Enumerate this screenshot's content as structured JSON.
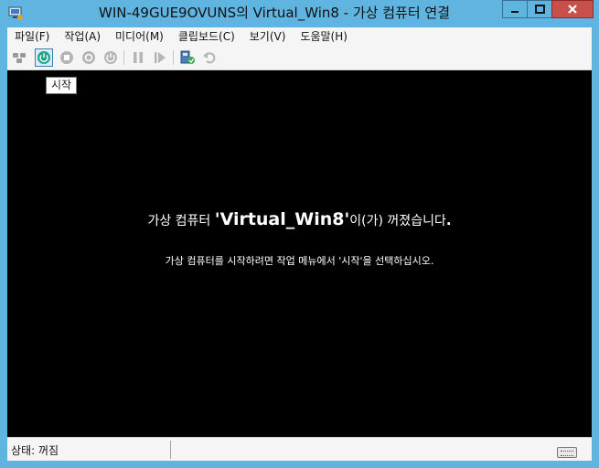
{
  "window": {
    "title": "WIN-49GUE9OVUNS의 Virtual_Win8 - 가상 컴퓨터 연결"
  },
  "menubar": {
    "items": [
      {
        "label": "파일(F)"
      },
      {
        "label": "작업(A)"
      },
      {
        "label": "미디어(M)"
      },
      {
        "label": "클립보드(C)"
      },
      {
        "label": "보기(V)"
      },
      {
        "label": "도움말(H)"
      }
    ]
  },
  "toolbar": {
    "tooltip": "시작",
    "buttons": [
      {
        "icon": "ctrl-alt-del-icon"
      },
      {
        "icon": "start-icon"
      },
      {
        "icon": "turn-off-icon"
      },
      {
        "icon": "shutdown-icon"
      },
      {
        "icon": "power-icon"
      },
      {
        "icon": "pause-icon"
      },
      {
        "icon": "resume-icon"
      },
      {
        "icon": "checkpoint-icon"
      },
      {
        "icon": "revert-icon"
      }
    ]
  },
  "screen": {
    "prefix": "가상 컴퓨터 ",
    "vm_name": "'Virtual_Win8'",
    "suffix": "이(가) 꺼졌습니다",
    "period": ".",
    "instruction": "가상 컴퓨터를 시작하려면 작업 메뉴에서 '시작'을 선택하십시오."
  },
  "statusbar": {
    "status": "상태: 꺼짐",
    "keyboard_icon": "keyboard-icon"
  },
  "colors": {
    "chrome": "#5fb4e0",
    "close_button": "#c7504a",
    "start_icon": "#1fa58a",
    "screen": "#000000"
  }
}
